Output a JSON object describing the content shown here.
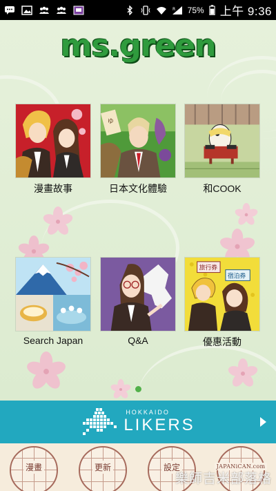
{
  "status_bar": {
    "battery": "75%",
    "time": "上午 9:36",
    "icons": [
      "chat-icon",
      "image-icon",
      "group-icon",
      "group-icon",
      "tv-icon",
      "bluetooth-icon",
      "vibrate-icon",
      "wifi-icon",
      "signal-icon",
      "battery-icon"
    ]
  },
  "app": {
    "logo_text": "ms.green"
  },
  "menu": {
    "items": [
      {
        "label": "漫畫故事"
      },
      {
        "label": "日本文化體驗"
      },
      {
        "label": "和COOK"
      },
      {
        "label": "Search Japan"
      },
      {
        "label": "Q&A"
      },
      {
        "label": "優惠活動"
      }
    ],
    "thumb_badges": {
      "travel": "旅行券",
      "hotel": "宿泊券",
      "rice": "ゆ"
    },
    "page_indicator": {
      "current": 1,
      "total": 1
    }
  },
  "banner": {
    "subtitle": "HOKKAIDO",
    "title": "LIKERS"
  },
  "tabs": [
    {
      "label": "漫畫"
    },
    {
      "label": "更新"
    },
    {
      "label": "設定"
    },
    {
      "label": "JAPANiCAN.com"
    }
  ],
  "watermark": "樂師吉米部落格",
  "colors": {
    "background": "#e3efd7",
    "logo_green": "#2f9b3d",
    "banner": "#22a8bf",
    "tab_border": "#a66a5c",
    "tab_text": "#7a3d32",
    "page_dot": "#52b04a"
  }
}
